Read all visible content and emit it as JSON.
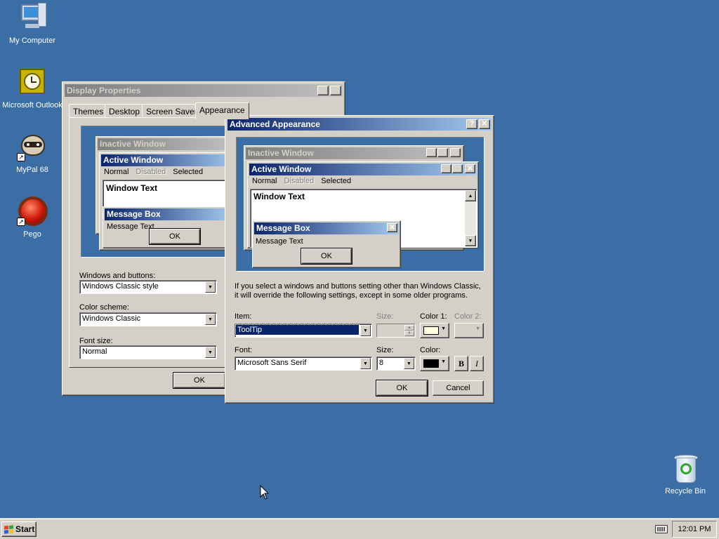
{
  "desktop": {
    "icons": [
      {
        "label": "My Computer",
        "icon": "my-computer-icon"
      },
      {
        "label": "Microsoft Outlook",
        "icon": "outlook-icon"
      },
      {
        "label": "MyPal 68",
        "icon": "mypal-raccoon-icon"
      },
      {
        "label": "Pego",
        "icon": "pego-red-ball-icon"
      },
      {
        "label": "Recycle Bin",
        "icon": "recycle-bin-icon"
      }
    ]
  },
  "display_props": {
    "title": "Display Properties",
    "tabs": [
      "Themes",
      "Desktop",
      "Screen Saver",
      "Appearance"
    ],
    "preview": {
      "inactive": "Inactive Window",
      "active": "Active Window",
      "menu": [
        "Normal",
        "Disabled",
        "Selected"
      ],
      "window_text": "Window Text",
      "msgbox_title": "Message Box",
      "msgbox_text": "Message Text",
      "ok": "OK"
    },
    "windows_buttons_label": "Windows and buttons:",
    "windows_buttons_value": "Windows Classic style",
    "color_scheme_label": "Color scheme:",
    "color_scheme_value": "Windows Classic",
    "font_size_label": "Font size:",
    "font_size_value": "Normal",
    "ok": "OK"
  },
  "advanced": {
    "title": "Advanced Appearance",
    "preview": {
      "inactive": "Inactive Window",
      "active": "Active Window",
      "menu": [
        "Normal",
        "Disabled",
        "Selected"
      ],
      "window_text": "Window Text",
      "msgbox_title": "Message Box",
      "msgbox_text": "Message Text",
      "ok": "OK"
    },
    "info_line1": "If you select a windows and buttons setting other than Windows Classic,",
    "info_line2": "it will override the following settings, except in some older programs.",
    "item_label": "Item:",
    "item_value": "ToolTip",
    "size_label": "Size:",
    "color1_label": "Color 1:",
    "color2_label": "Color 2:",
    "font_label": "Font:",
    "font_value": "Microsoft Sans Serif",
    "font_size_label": "Size:",
    "font_size_value": "8",
    "font_color_label": "Color:",
    "bold": "B",
    "italic": "I",
    "ok": "OK",
    "cancel": "Cancel",
    "color1_hex": "#ffffe1",
    "font_color_hex": "#000000"
  },
  "taskbar": {
    "start": "Start",
    "clock": "12:01 PM"
  }
}
